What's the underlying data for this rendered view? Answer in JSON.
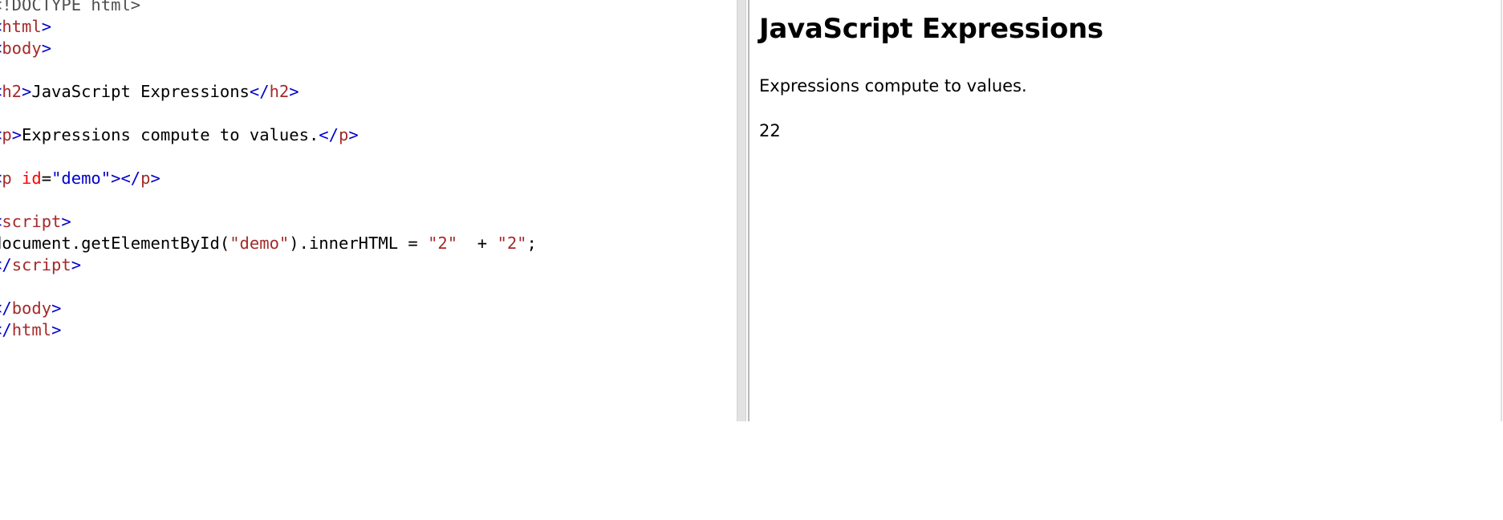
{
  "editor": {
    "lines": [
      [
        {
          "t": "<!DOCTYPE html>",
          "c": "doctype"
        }
      ],
      [
        {
          "t": "<",
          "c": "bracket"
        },
        {
          "t": "html",
          "c": "tag"
        },
        {
          "t": ">",
          "c": "bracket"
        }
      ],
      [
        {
          "t": "<",
          "c": "bracket"
        },
        {
          "t": "body",
          "c": "tag"
        },
        {
          "t": ">",
          "c": "bracket"
        }
      ],
      [],
      [
        {
          "t": "<",
          "c": "bracket"
        },
        {
          "t": "h2",
          "c": "tag"
        },
        {
          "t": ">",
          "c": "bracket"
        },
        {
          "t": "JavaScript Expressions",
          "c": "plain"
        },
        {
          "t": "</",
          "c": "bracket"
        },
        {
          "t": "h2",
          "c": "tag"
        },
        {
          "t": ">",
          "c": "bracket"
        }
      ],
      [],
      [
        {
          "t": "<",
          "c": "bracket"
        },
        {
          "t": "p",
          "c": "tag"
        },
        {
          "t": ">",
          "c": "bracket"
        },
        {
          "t": "Expressions compute to values.",
          "c": "plain"
        },
        {
          "t": "</",
          "c": "bracket"
        },
        {
          "t": "p",
          "c": "tag"
        },
        {
          "t": ">",
          "c": "bracket"
        }
      ],
      [],
      [
        {
          "t": "<",
          "c": "bracket"
        },
        {
          "t": "p",
          "c": "tag"
        },
        {
          "t": " ",
          "c": "plain"
        },
        {
          "t": "id",
          "c": "attr"
        },
        {
          "t": "=",
          "c": "plain"
        },
        {
          "t": "\"demo\"",
          "c": "value"
        },
        {
          "t": "></",
          "c": "bracket"
        },
        {
          "t": "p",
          "c": "tag"
        },
        {
          "t": ">",
          "c": "bracket"
        }
      ],
      [],
      [
        {
          "t": "<",
          "c": "bracket"
        },
        {
          "t": "script",
          "c": "tag"
        },
        {
          "t": ">",
          "c": "bracket"
        }
      ],
      [
        {
          "t": "document.getElementById(",
          "c": "plain"
        },
        {
          "t": "\"demo\"",
          "c": "string"
        },
        {
          "t": ").innerHTML = ",
          "c": "plain"
        },
        {
          "t": "\"2\"",
          "c": "string"
        },
        {
          "t": "  + ",
          "c": "plain"
        },
        {
          "t": "\"2\"",
          "c": "string"
        },
        {
          "t": ";",
          "c": "plain"
        }
      ],
      [
        {
          "t": "</",
          "c": "bracket"
        },
        {
          "t": "script",
          "c": "tag"
        },
        {
          "t": ">",
          "c": "bracket"
        }
      ],
      [],
      [
        {
          "t": "</",
          "c": "bracket"
        },
        {
          "t": "body",
          "c": "tag"
        },
        {
          "t": ">",
          "c": "bracket"
        }
      ],
      [
        {
          "t": "</",
          "c": "bracket"
        },
        {
          "t": "html",
          "c": "tag"
        },
        {
          "t": ">",
          "c": "bracket"
        }
      ]
    ]
  },
  "preview": {
    "heading": "JavaScript Expressions",
    "paragraph": "Expressions compute to values.",
    "demo_output": "22"
  },
  "colors": {
    "bracket": "#0000cd",
    "tag": "#a52a2a",
    "attr": "#ff0000",
    "value": "#0000cd",
    "string": "#a52a2a",
    "doctype": "#505050",
    "splitter": "#e2e2e2"
  }
}
